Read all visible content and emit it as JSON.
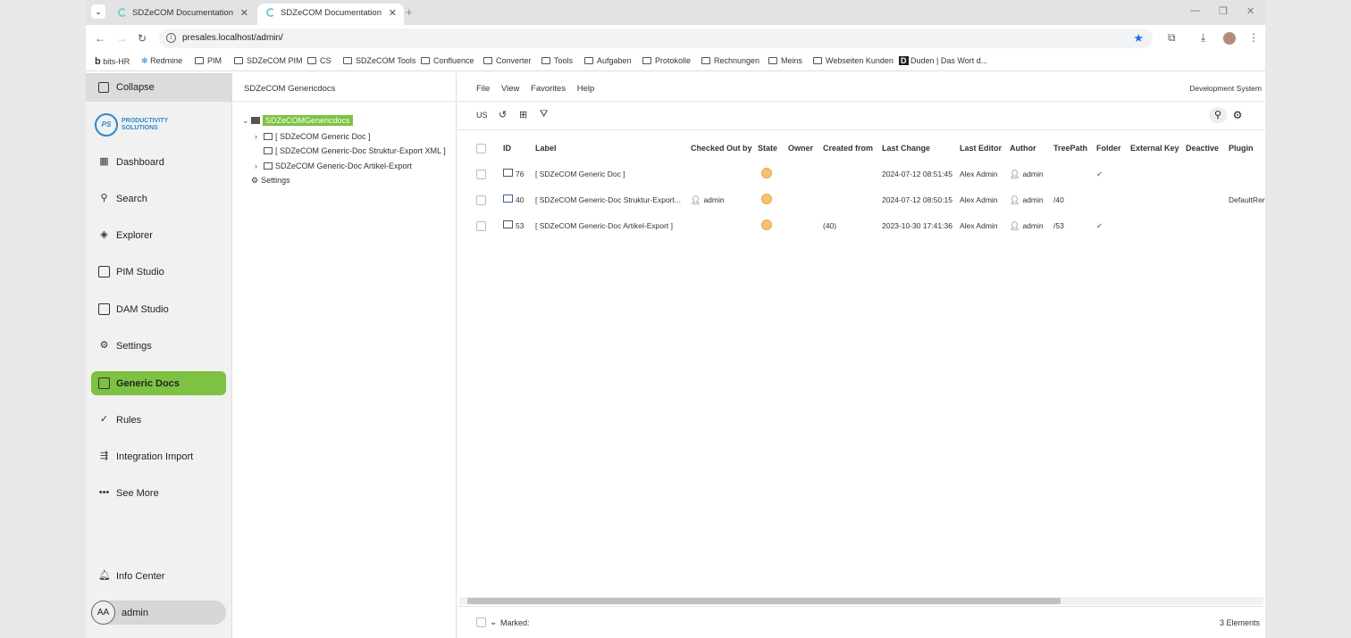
{
  "browser": {
    "tabs": [
      {
        "title": "SDZeCOM Documentation"
      },
      {
        "title": "SDZeCOM Documentation"
      }
    ],
    "url": "presales.localhost/admin/",
    "bookmarks": [
      "bits-HR",
      "Redmine",
      "PIM",
      "SDZeCOM PIM",
      "CS",
      "SDZeCOM Tools",
      "Confluence",
      "Converter",
      "Tools",
      "Aufgaben",
      "Protokolle",
      "Rechnungen",
      "Meins",
      "Webseiten Kunden",
      "Duden | Das Wort d..."
    ]
  },
  "sidebar": {
    "collapse_label": "Collapse",
    "logo_line1": "PRODUCTIVITY",
    "logo_line2": "SOLUTIONS",
    "logo_mark": "PS",
    "items": [
      {
        "label": "Dashboard",
        "icon": "dashboard-icon"
      },
      {
        "label": "Search",
        "icon": "search-icon"
      },
      {
        "label": "Explorer",
        "icon": "explorer-icon"
      },
      {
        "label": "PIM Studio",
        "icon": "pim-icon"
      },
      {
        "label": "DAM Studio",
        "icon": "image-icon"
      },
      {
        "label": "Settings",
        "icon": "gear-icon"
      },
      {
        "label": "Generic Docs",
        "icon": "docs-icon"
      },
      {
        "label": "Rules",
        "icon": "check-icon"
      },
      {
        "label": "Integration Import",
        "icon": "import-icon"
      },
      {
        "label": "See More",
        "icon": "more-icon"
      }
    ],
    "info_center": "Info Center",
    "user_initials": "AA",
    "user_name": "admin"
  },
  "tree": {
    "title": "SDZeCOM Genericdocs",
    "root": "SDZeCOMGenericdocs",
    "nodes": [
      "[ SDZeCOM Generic Doc ]",
      "[ SDZeCOM Generic-Doc Struktur-Export XML ]",
      "SDZeCOM Generic-Doc Artikel-Export",
      "Settings"
    ]
  },
  "main": {
    "menu": [
      "File",
      "View",
      "Favorites",
      "Help"
    ],
    "system": "Development System",
    "lang": "US",
    "columns": [
      "ID",
      "Label",
      "Checked Out by",
      "State",
      "Owner",
      "Created from",
      "Last Change",
      "Last Editor",
      "Author",
      "TreePath",
      "Folder",
      "External Key",
      "Deactive",
      "Plugin"
    ],
    "rows": [
      {
        "id": "76",
        "label": "[ SDZeCOM Generic Doc ]",
        "checked_out": "",
        "created_from": "",
        "last_change": "2024-07-12 08:51:45",
        "last_editor": "Alex Admin",
        "author": "admin",
        "treepath": "",
        "folder": "✔",
        "plugin": ""
      },
      {
        "id": "40",
        "label": "[ SDZeCOM Generic-Doc Struktur-Export...",
        "checked_out": "admin",
        "created_from": "",
        "last_change": "2024-07-12 08:50:15",
        "last_editor": "Alex Admin",
        "author": "admin",
        "treepath": "/40",
        "folder": "",
        "plugin": "DefaultRen"
      },
      {
        "id": "53",
        "label": "[ SDZeCOM Generic-Doc Artikel-Export ]",
        "checked_out": "",
        "created_from": "(40)",
        "last_change": "2023-10-30 17:41:36",
        "last_editor": "Alex Admin",
        "author": "admin",
        "treepath": "/53",
        "folder": "✔",
        "plugin": ""
      }
    ],
    "marked_label": "Marked:",
    "element_count": "3 Elements"
  },
  "colors": {
    "accent": "#7dc242",
    "state": "#f6c26b",
    "brand": "#2b8ac9"
  }
}
